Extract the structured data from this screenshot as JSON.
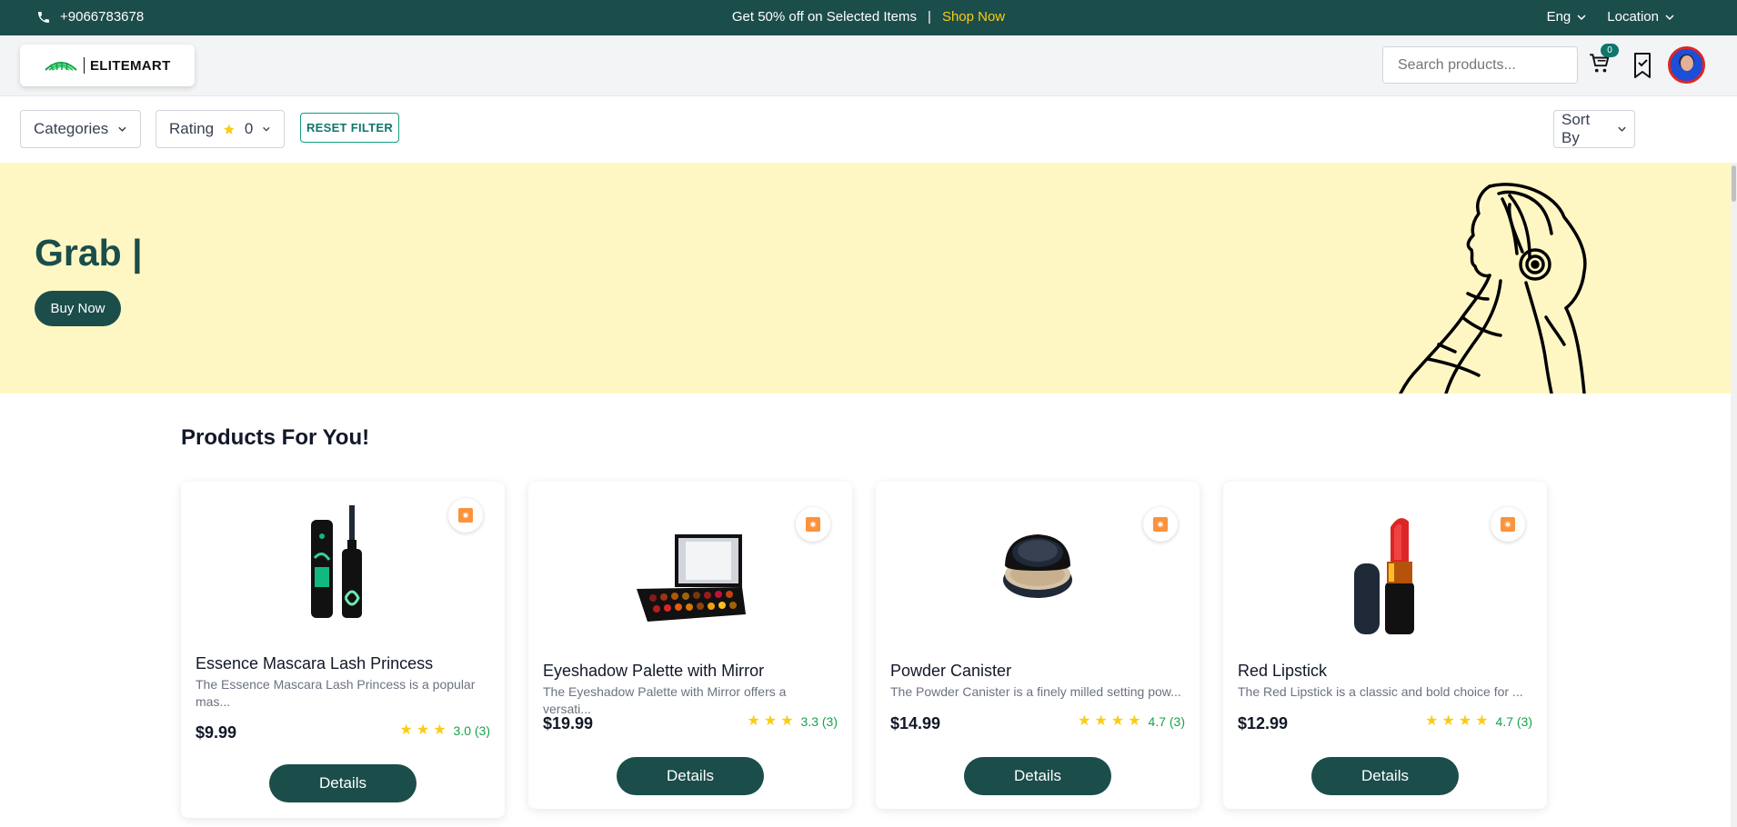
{
  "topbar": {
    "phone": "+9066783678",
    "promo_text": "Get 50% off on Selected Items",
    "separator": "|",
    "promo_link": "Shop Now",
    "language": "Eng",
    "location": "Location"
  },
  "header": {
    "logo_text": "ELITEMART",
    "search_placeholder": "Search products...",
    "cart_count": "0"
  },
  "filters": {
    "categories_label": "Categories",
    "rating_label": "Rating",
    "rating_value": "0",
    "reset_label": "RESET FILTER",
    "sort_label": "Sort By"
  },
  "hero": {
    "title": "Grab |",
    "button_label": "Buy Now"
  },
  "section_title": "Products For You!",
  "products": [
    {
      "name": "Essence Mascara Lash Princess",
      "description": "The Essence Mascara Lash Princess is a popular mas...",
      "price": "$9.99",
      "rating_text": "3.0 (3)",
      "stars": 3,
      "button_label": "Details"
    },
    {
      "name": "Eyeshadow Palette with Mirror",
      "description": "The Eyeshadow Palette with Mirror offers a versati...",
      "price": "$19.99",
      "rating_text": "3.3 (3)",
      "stars": 3,
      "button_label": "Details"
    },
    {
      "name": "Powder Canister",
      "description": "The Powder Canister is a finely milled setting pow...",
      "price": "$14.99",
      "rating_text": "4.7 (3)",
      "stars": 4,
      "button_label": "Details"
    },
    {
      "name": "Red Lipstick",
      "description": "The Red Lipstick is a classic and bold choice for ...",
      "price": "$12.99",
      "rating_text": "4.7 (3)",
      "stars": 4,
      "button_label": "Details"
    }
  ],
  "colors": {
    "brand": "#1b4d4b",
    "accent_yellow": "#facc15",
    "hero_bg": "#fef7c3",
    "rating_green": "#16a34a"
  },
  "icons": [
    "phone-icon",
    "chevron-down-icon",
    "cart-icon",
    "bookmark-icon",
    "star-icon",
    "badge-icon"
  ]
}
